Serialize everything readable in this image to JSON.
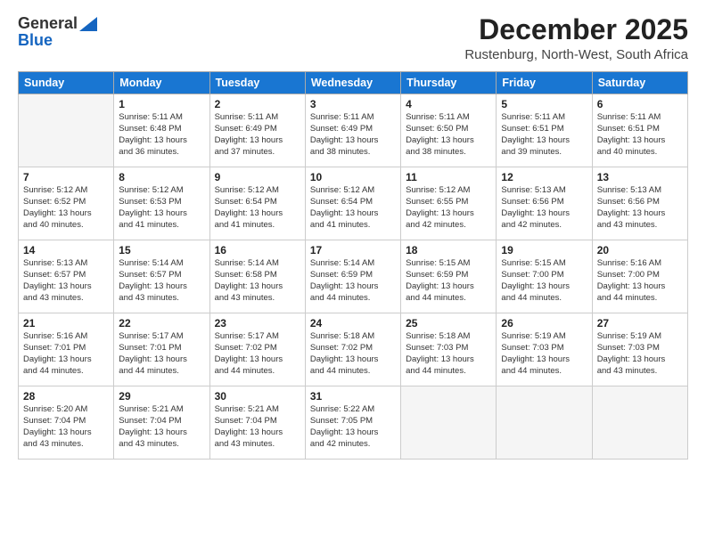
{
  "logo": {
    "line1": "General",
    "line2": "Blue"
  },
  "header": {
    "title": "December 2025",
    "subtitle": "Rustenburg, North-West, South Africa"
  },
  "weekdays": [
    "Sunday",
    "Monday",
    "Tuesday",
    "Wednesday",
    "Thursday",
    "Friday",
    "Saturday"
  ],
  "weeks": [
    [
      {
        "day": "",
        "lines": []
      },
      {
        "day": "1",
        "lines": [
          "Sunrise: 5:11 AM",
          "Sunset: 6:48 PM",
          "Daylight: 13 hours",
          "and 36 minutes."
        ]
      },
      {
        "day": "2",
        "lines": [
          "Sunrise: 5:11 AM",
          "Sunset: 6:49 PM",
          "Daylight: 13 hours",
          "and 37 minutes."
        ]
      },
      {
        "day": "3",
        "lines": [
          "Sunrise: 5:11 AM",
          "Sunset: 6:49 PM",
          "Daylight: 13 hours",
          "and 38 minutes."
        ]
      },
      {
        "day": "4",
        "lines": [
          "Sunrise: 5:11 AM",
          "Sunset: 6:50 PM",
          "Daylight: 13 hours",
          "and 38 minutes."
        ]
      },
      {
        "day": "5",
        "lines": [
          "Sunrise: 5:11 AM",
          "Sunset: 6:51 PM",
          "Daylight: 13 hours",
          "and 39 minutes."
        ]
      },
      {
        "day": "6",
        "lines": [
          "Sunrise: 5:11 AM",
          "Sunset: 6:51 PM",
          "Daylight: 13 hours",
          "and 40 minutes."
        ]
      }
    ],
    [
      {
        "day": "7",
        "lines": [
          "Sunrise: 5:12 AM",
          "Sunset: 6:52 PM",
          "Daylight: 13 hours",
          "and 40 minutes."
        ]
      },
      {
        "day": "8",
        "lines": [
          "Sunrise: 5:12 AM",
          "Sunset: 6:53 PM",
          "Daylight: 13 hours",
          "and 41 minutes."
        ]
      },
      {
        "day": "9",
        "lines": [
          "Sunrise: 5:12 AM",
          "Sunset: 6:54 PM",
          "Daylight: 13 hours",
          "and 41 minutes."
        ]
      },
      {
        "day": "10",
        "lines": [
          "Sunrise: 5:12 AM",
          "Sunset: 6:54 PM",
          "Daylight: 13 hours",
          "and 41 minutes."
        ]
      },
      {
        "day": "11",
        "lines": [
          "Sunrise: 5:12 AM",
          "Sunset: 6:55 PM",
          "Daylight: 13 hours",
          "and 42 minutes."
        ]
      },
      {
        "day": "12",
        "lines": [
          "Sunrise: 5:13 AM",
          "Sunset: 6:56 PM",
          "Daylight: 13 hours",
          "and 42 minutes."
        ]
      },
      {
        "day": "13",
        "lines": [
          "Sunrise: 5:13 AM",
          "Sunset: 6:56 PM",
          "Daylight: 13 hours",
          "and 43 minutes."
        ]
      }
    ],
    [
      {
        "day": "14",
        "lines": [
          "Sunrise: 5:13 AM",
          "Sunset: 6:57 PM",
          "Daylight: 13 hours",
          "and 43 minutes."
        ]
      },
      {
        "day": "15",
        "lines": [
          "Sunrise: 5:14 AM",
          "Sunset: 6:57 PM",
          "Daylight: 13 hours",
          "and 43 minutes."
        ]
      },
      {
        "day": "16",
        "lines": [
          "Sunrise: 5:14 AM",
          "Sunset: 6:58 PM",
          "Daylight: 13 hours",
          "and 43 minutes."
        ]
      },
      {
        "day": "17",
        "lines": [
          "Sunrise: 5:14 AM",
          "Sunset: 6:59 PM",
          "Daylight: 13 hours",
          "and 44 minutes."
        ]
      },
      {
        "day": "18",
        "lines": [
          "Sunrise: 5:15 AM",
          "Sunset: 6:59 PM",
          "Daylight: 13 hours",
          "and 44 minutes."
        ]
      },
      {
        "day": "19",
        "lines": [
          "Sunrise: 5:15 AM",
          "Sunset: 7:00 PM",
          "Daylight: 13 hours",
          "and 44 minutes."
        ]
      },
      {
        "day": "20",
        "lines": [
          "Sunrise: 5:16 AM",
          "Sunset: 7:00 PM",
          "Daylight: 13 hours",
          "and 44 minutes."
        ]
      }
    ],
    [
      {
        "day": "21",
        "lines": [
          "Sunrise: 5:16 AM",
          "Sunset: 7:01 PM",
          "Daylight: 13 hours",
          "and 44 minutes."
        ]
      },
      {
        "day": "22",
        "lines": [
          "Sunrise: 5:17 AM",
          "Sunset: 7:01 PM",
          "Daylight: 13 hours",
          "and 44 minutes."
        ]
      },
      {
        "day": "23",
        "lines": [
          "Sunrise: 5:17 AM",
          "Sunset: 7:02 PM",
          "Daylight: 13 hours",
          "and 44 minutes."
        ]
      },
      {
        "day": "24",
        "lines": [
          "Sunrise: 5:18 AM",
          "Sunset: 7:02 PM",
          "Daylight: 13 hours",
          "and 44 minutes."
        ]
      },
      {
        "day": "25",
        "lines": [
          "Sunrise: 5:18 AM",
          "Sunset: 7:03 PM",
          "Daylight: 13 hours",
          "and 44 minutes."
        ]
      },
      {
        "day": "26",
        "lines": [
          "Sunrise: 5:19 AM",
          "Sunset: 7:03 PM",
          "Daylight: 13 hours",
          "and 44 minutes."
        ]
      },
      {
        "day": "27",
        "lines": [
          "Sunrise: 5:19 AM",
          "Sunset: 7:03 PM",
          "Daylight: 13 hours",
          "and 43 minutes."
        ]
      }
    ],
    [
      {
        "day": "28",
        "lines": [
          "Sunrise: 5:20 AM",
          "Sunset: 7:04 PM",
          "Daylight: 13 hours",
          "and 43 minutes."
        ]
      },
      {
        "day": "29",
        "lines": [
          "Sunrise: 5:21 AM",
          "Sunset: 7:04 PM",
          "Daylight: 13 hours",
          "and 43 minutes."
        ]
      },
      {
        "day": "30",
        "lines": [
          "Sunrise: 5:21 AM",
          "Sunset: 7:04 PM",
          "Daylight: 13 hours",
          "and 43 minutes."
        ]
      },
      {
        "day": "31",
        "lines": [
          "Sunrise: 5:22 AM",
          "Sunset: 7:05 PM",
          "Daylight: 13 hours",
          "and 42 minutes."
        ]
      },
      {
        "day": "",
        "lines": []
      },
      {
        "day": "",
        "lines": []
      },
      {
        "day": "",
        "lines": []
      }
    ]
  ]
}
